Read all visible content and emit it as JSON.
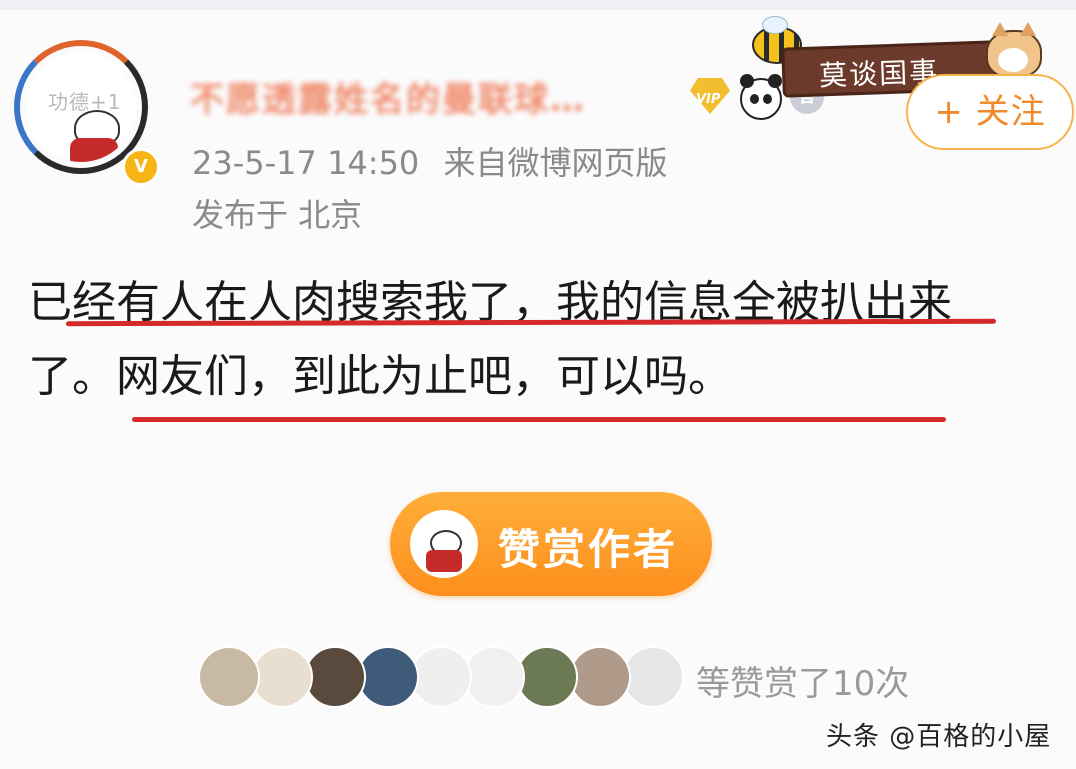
{
  "user": {
    "avatar_text": "功德+1",
    "name": "不愿透露姓名的曼联球…",
    "badges": [
      "vip-diamond-icon",
      "panda-icon",
      "da-icon"
    ],
    "vip_label": "VIP",
    "da_label": "答"
  },
  "decoration": {
    "sign_text": "莫谈国事"
  },
  "follow": {
    "label": "+ 关注"
  },
  "meta": {
    "timestamp": "23-5-17 14:50",
    "source": "来自微博网页版",
    "location": "发布于 北京"
  },
  "post": {
    "line1": "已经有人在人肉搜索我了，我的信息全被扒出来",
    "line2": "了。网友们，到此为止吧，可以吗。"
  },
  "reward": {
    "label": "赞赏作者"
  },
  "supporters": {
    "summary": "等赞赏了10次",
    "avatar_colors": [
      "#c7b9a3",
      "#e8dfd0",
      "#5a4a3e",
      "#3e5b7a",
      "#efefef",
      "#f0f0f0",
      "#6b7a55",
      "#b09a8a",
      "#e6e6e6"
    ]
  },
  "watermark": {
    "text": "头条 @百格的小屋"
  },
  "colors": {
    "accent": "#f08a2a",
    "reward_orange": "#fd8f1c",
    "underline_red": "#d62a2a",
    "meta_gray": "#8a8a8a"
  }
}
